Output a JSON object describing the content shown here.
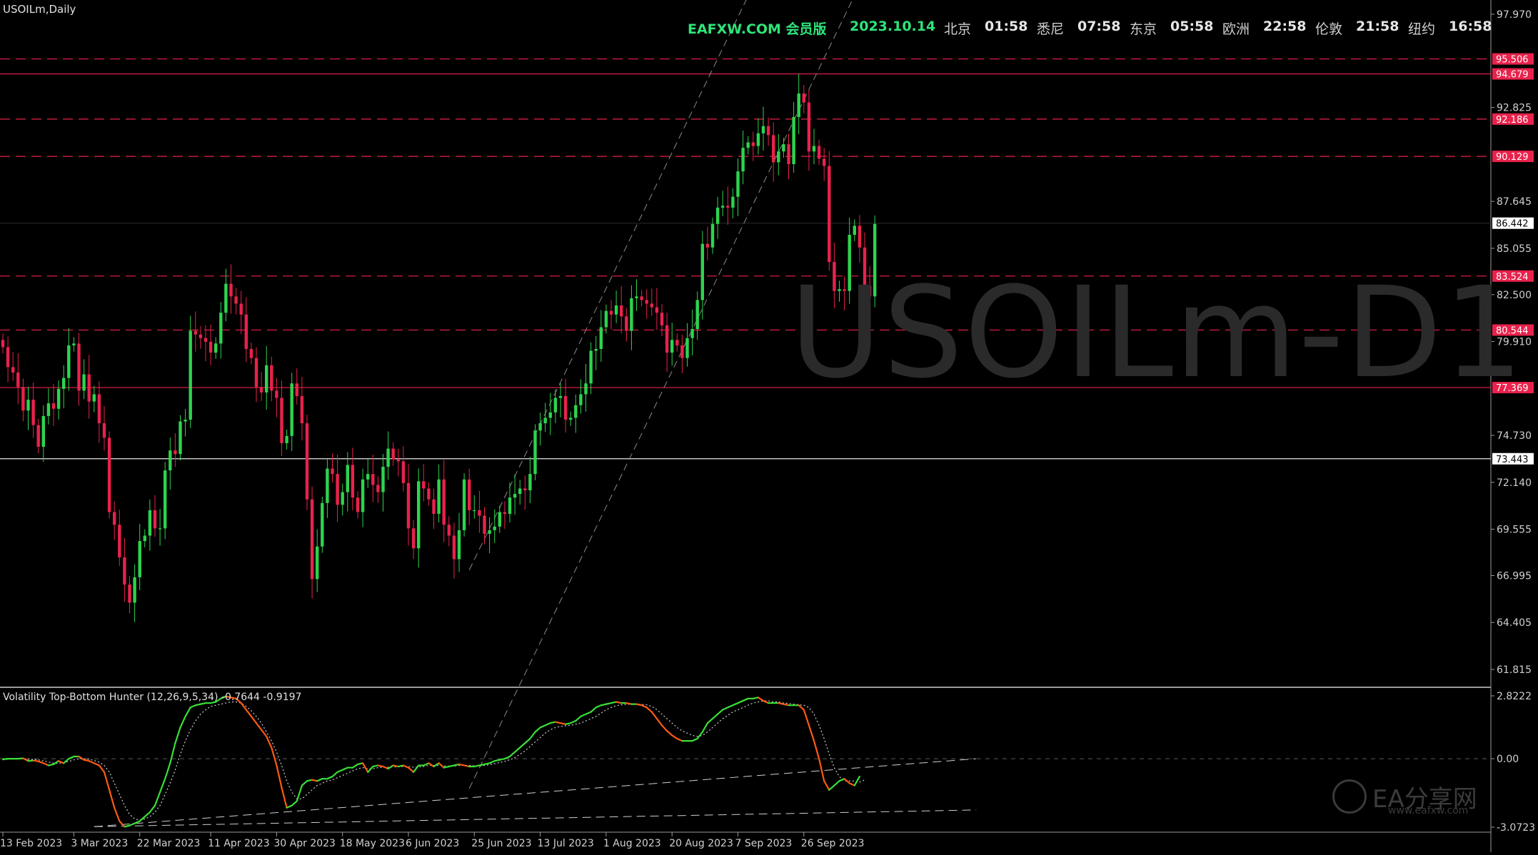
{
  "window": {
    "symbol_label": "USOILm,Daily",
    "watermark": "USOILm-D1"
  },
  "header": {
    "brand": "EAFXW.COM 会员版",
    "date": "2023.10.14",
    "clocks": [
      {
        "city": "北京",
        "time": "01:58"
      },
      {
        "city": "悉尼",
        "time": "07:58"
      },
      {
        "city": "东京",
        "time": "05:58"
      },
      {
        "city": "欧洲",
        "time": "22:58"
      },
      {
        "city": "伦敦",
        "time": "21:58"
      },
      {
        "city": "纽约",
        "time": "16:58"
      }
    ]
  },
  "logo": {
    "name": "EA分享网",
    "url": "www.eafxw.com"
  },
  "colors": {
    "bull": "#2dd44e",
    "bear": "#e8224c",
    "level": "#e8224c",
    "osc_up": "#39e036",
    "osc_down": "#ff5a14"
  },
  "chart_data": [
    {
      "type": "candlestick",
      "title": "USOILm,Daily",
      "ylim": [
        61.815,
        97.97
      ],
      "y_ticks": [
        97.97,
        92.825,
        87.645,
        85.055,
        82.5,
        79.91,
        74.73,
        72.14,
        69.555,
        66.995,
        64.405,
        61.815
      ],
      "x_tick_labels": [
        {
          "i": 0,
          "label": "13 Feb 2023"
        },
        {
          "i": 14,
          "label": "3 Mar 2023"
        },
        {
          "i": 27,
          "label": "22 Mar 2023"
        },
        {
          "i": 41,
          "label": "11 Apr 2023"
        },
        {
          "i": 54,
          "label": "30 Apr 2023"
        },
        {
          "i": 67,
          "label": "18 May 2023"
        },
        {
          "i": 80,
          "label": "6 Jun 2023"
        },
        {
          "i": 93,
          "label": "25 Jun 2023"
        },
        {
          "i": 106,
          "label": "13 Jul 2023"
        },
        {
          "i": 119,
          "label": "1 Aug 2023"
        },
        {
          "i": 132,
          "label": "20 Aug 2023"
        },
        {
          "i": 145,
          "label": "7 Sep 2023"
        },
        {
          "i": 158,
          "label": "26 Sep 2023"
        }
      ],
      "bar_count": 173,
      "price_levels": [
        {
          "value": 95.506,
          "style": "dashed"
        },
        {
          "value": 94.679,
          "style": "solid"
        },
        {
          "value": 92.186,
          "style": "dashed"
        },
        {
          "value": 90.129,
          "style": "dashed"
        },
        {
          "value": 83.524,
          "style": "dashed"
        },
        {
          "value": 80.544,
          "style": "dashed"
        },
        {
          "value": 77.369,
          "style": "solid"
        }
      ],
      "current_price": 86.442,
      "horizontal_line": 73.443,
      "channel": {
        "start": {
          "i": 92,
          "price": 67.3
        },
        "end": {
          "i": 121,
          "price": 84.0
        },
        "parallel_anchor": {
          "i": 131,
          "price": 77.7
        }
      },
      "closes": [
        79.6,
        78.5,
        78.2,
        77.4,
        76.1,
        76.7,
        75.3,
        74.1,
        75.8,
        76.5,
        76.2,
        77.3,
        77.9,
        79.7,
        79.8,
        77.2,
        78.1,
        76.6,
        77.0,
        75.4,
        74.6,
        70.5,
        69.8,
        68.0,
        66.5,
        65.5,
        66.9,
        68.9,
        69.2,
        70.6,
        69.6,
        69.6,
        72.8,
        73.9,
        73.7,
        75.5,
        75.6,
        80.5,
        80.3,
        80.1,
        79.9,
        79.3,
        79.8,
        81.5,
        83.1,
        82.4,
        82.0,
        81.4,
        79.5,
        79.0,
        77.4,
        77.1,
        78.6,
        77.2,
        76.8,
        74.3,
        74.7,
        77.6,
        76.9,
        75.4,
        71.2,
        66.8,
        68.6,
        71.0,
        72.9,
        72.6,
        70.9,
        71.6,
        73.1,
        71.3,
        70.5,
        72.3,
        72.6,
        72.0,
        71.6,
        73.0,
        74.0,
        73.4,
        73.3,
        72.1,
        69.6,
        68.5,
        72.2,
        71.8,
        71.2,
        70.4,
        72.3,
        69.8,
        69.2,
        67.9,
        69.5,
        72.3,
        70.6,
        70.6,
        70.3,
        69.3,
        69.5,
        69.7,
        70.5,
        70.4,
        71.3,
        71.5,
        71.8,
        71.7,
        72.6,
        75.0,
        75.4,
        75.7,
        76.0,
        76.8,
        76.9,
        75.6,
        75.7,
        76.4,
        77.0,
        77.6,
        79.4,
        79.5,
        80.7,
        81.6,
        81.4,
        81.9,
        81.3,
        80.5,
        82.3,
        82.4,
        82.2,
        82.0,
        81.8,
        81.5,
        80.8,
        79.3,
        80.0,
        79.7,
        79.0,
        80.1,
        80.6,
        82.2,
        85.3,
        85.1,
        86.4,
        87.3,
        87.4,
        87.3,
        87.9,
        89.3,
        90.6,
        90.9,
        90.7,
        91.4,
        91.8,
        91.3,
        89.8,
        90.4,
        90.8,
        89.7,
        92.3,
        93.6,
        93.1,
        90.4,
        90.7,
        90.0,
        89.6,
        84.3,
        82.7,
        82.8,
        82.7,
        85.8,
        86.3,
        85.1,
        83.0,
        82.4,
        86.4
      ]
    },
    {
      "type": "line",
      "title": "Volatility Top-Bottom Hunter (12,26,9,5,34) -0.7644 -0.9197",
      "ylim": [
        -3.0723,
        2.8222
      ],
      "y_ticks": [
        2.8222,
        0.0,
        -3.0723
      ],
      "series": [
        {
          "values": [
            -0.02,
            0.0,
            0.0,
            0.0,
            0.02,
            -0.1,
            -0.08,
            -0.12,
            -0.2,
            -0.3,
            -0.25,
            -0.1,
            -0.2,
            0.0,
            0.1,
            0.1,
            -0.05,
            -0.1,
            -0.2,
            -0.3,
            -0.6,
            -1.4,
            -2.2,
            -2.8,
            -3.05,
            -3.0,
            -2.9,
            -2.8,
            -2.6,
            -2.4,
            -2.1,
            -1.5,
            -0.9,
            -0.2,
            0.7,
            1.4,
            1.9,
            2.3,
            2.4,
            2.45,
            2.5,
            2.5,
            2.55,
            2.7,
            2.8,
            2.75,
            2.7,
            2.5,
            2.2,
            1.9,
            1.6,
            1.3,
            1.0,
            0.5,
            -0.3,
            -1.3,
            -2.2,
            -2.1,
            -1.9,
            -1.2,
            -1.0,
            -0.95,
            -1.0,
            -0.9,
            -0.9,
            -0.8,
            -0.6,
            -0.5,
            -0.4,
            -0.4,
            -0.25,
            -0.2,
            -0.6,
            -0.35,
            -0.3,
            -0.35,
            -0.45,
            -0.3,
            -0.35,
            -0.3,
            -0.4,
            -0.6,
            -0.3,
            -0.3,
            -0.2,
            -0.35,
            -0.2,
            -0.4,
            -0.35,
            -0.3,
            -0.25,
            -0.3,
            -0.35,
            -0.35,
            -0.3,
            -0.25,
            -0.2,
            -0.1,
            -0.05,
            0.0,
            0.1,
            0.3,
            0.5,
            0.7,
            0.9,
            1.2,
            1.4,
            1.5,
            1.6,
            1.65,
            1.6,
            1.55,
            1.6,
            1.7,
            1.9,
            2.0,
            2.1,
            2.3,
            2.4,
            2.45,
            2.5,
            2.55,
            2.5,
            2.5,
            2.45,
            2.45,
            2.4,
            2.3,
            2.1,
            1.8,
            1.5,
            1.25,
            1.05,
            0.9,
            0.8,
            0.8,
            0.8,
            0.9,
            1.2,
            1.6,
            1.8,
            2.0,
            2.2,
            2.3,
            2.4,
            2.5,
            2.6,
            2.7,
            2.7,
            2.75,
            2.6,
            2.5,
            2.5,
            2.5,
            2.45,
            2.4,
            2.4,
            2.4,
            2.2,
            1.5,
            0.8,
            0.0,
            -1.0,
            -1.4,
            -1.2,
            -1.0,
            -0.9,
            -1.1,
            -1.2,
            -0.8
          ]
        },
        {
          "values": [
            -0.05,
            -0.02,
            -0.01,
            0.0,
            0.0,
            -0.02,
            -0.03,
            -0.05,
            -0.1,
            -0.15,
            -0.2,
            -0.2,
            -0.18,
            -0.12,
            -0.05,
            0.0,
            0.0,
            -0.02,
            -0.08,
            -0.15,
            -0.3,
            -0.6,
            -1.1,
            -1.6,
            -2.1,
            -2.5,
            -2.7,
            -2.75,
            -2.7,
            -2.6,
            -2.4,
            -2.1,
            -1.6,
            -1.1,
            -0.5,
            0.2,
            0.8,
            1.3,
            1.7,
            2.0,
            2.2,
            2.35,
            2.4,
            2.45,
            2.5,
            2.55,
            2.55,
            2.5,
            2.35,
            2.15,
            1.9,
            1.6,
            1.2,
            0.8,
            0.3,
            -0.3,
            -1.0,
            -1.5,
            -1.8,
            -1.8,
            -1.6,
            -1.4,
            -1.2,
            -1.1,
            -1.0,
            -0.95,
            -0.85,
            -0.75,
            -0.65,
            -0.55,
            -0.45,
            -0.4,
            -0.45,
            -0.45,
            -0.4,
            -0.38,
            -0.38,
            -0.37,
            -0.36,
            -0.35,
            -0.35,
            -0.38,
            -0.37,
            -0.35,
            -0.3,
            -0.3,
            -0.3,
            -0.32,
            -0.33,
            -0.33,
            -0.3,
            -0.3,
            -0.3,
            -0.32,
            -0.32,
            -0.3,
            -0.27,
            -0.22,
            -0.17,
            -0.12,
            -0.05,
            0.05,
            0.2,
            0.35,
            0.55,
            0.75,
            0.95,
            1.15,
            1.3,
            1.4,
            1.45,
            1.48,
            1.5,
            1.55,
            1.6,
            1.7,
            1.8,
            1.9,
            2.05,
            2.2,
            2.3,
            2.38,
            2.42,
            2.44,
            2.45,
            2.45,
            2.44,
            2.42,
            2.35,
            2.2,
            2.0,
            1.8,
            1.6,
            1.4,
            1.25,
            1.15,
            1.05,
            1.0,
            1.05,
            1.2,
            1.4,
            1.6,
            1.8,
            1.95,
            2.1,
            2.2,
            2.3,
            2.4,
            2.5,
            2.55,
            2.6,
            2.6,
            2.55,
            2.55,
            2.5,
            2.48,
            2.45,
            2.42,
            2.4,
            2.3,
            2.0,
            1.5,
            0.9,
            0.2,
            -0.4,
            -0.8,
            -1.0,
            -1.0,
            -1.0,
            -1.05,
            -0.95
          ]
        }
      ],
      "trendlines": [
        {
          "from": {
            "i": 18,
            "v": -3.05
          },
          "to": {
            "i": 192,
            "v": 0.0
          }
        },
        {
          "from": {
            "i": 18,
            "v": -3.05
          },
          "to": {
            "i": 192,
            "v": -2.3
          }
        }
      ]
    }
  ]
}
